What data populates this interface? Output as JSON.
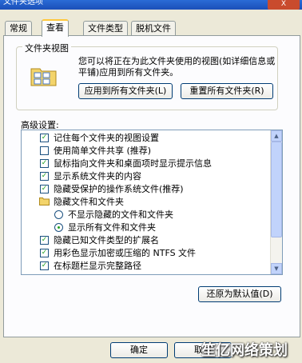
{
  "window": {
    "title": "文件夹选项",
    "close_label": "X"
  },
  "tabs": [
    {
      "label": "常规"
    },
    {
      "label": "查看"
    },
    {
      "label": "文件类型"
    },
    {
      "label": "脱机文件"
    }
  ],
  "folder_views": {
    "group_label": "文件夹视图",
    "description": "您可以将正在为此文件夹使用的视图(如详细信息或平铺)应用到所有文件夹。",
    "apply_button": "应用到所有文件夹(L)",
    "reset_button": "重置所有文件夹(R)"
  },
  "advanced": {
    "label": "高级设置:",
    "items": [
      {
        "text": "记住每个文件夹的视图设置",
        "kind": "checkbox",
        "checked": true
      },
      {
        "text": "使用简单文件共享 (推荐)",
        "kind": "checkbox",
        "checked": false
      },
      {
        "text": "鼠标指向文件夹和桌面项时显示提示信息",
        "kind": "checkbox",
        "checked": true
      },
      {
        "text": "显示系统文件夹的内容",
        "kind": "checkbox",
        "checked": true
      },
      {
        "text": "隐藏受保护的操作系统文件(推荐)",
        "kind": "checkbox",
        "checked": true
      },
      {
        "text": "隐藏文件和文件夹",
        "kind": "folder",
        "checked": false
      },
      {
        "text": "不显示隐藏的文件和文件夹",
        "kind": "radio",
        "checked": false
      },
      {
        "text": "显示所有文件和文件夹",
        "kind": "radio",
        "checked": true
      },
      {
        "text": "隐藏已知文件类型的扩展名",
        "kind": "checkbox",
        "checked": true
      },
      {
        "text": "用彩色显示加密或压缩的 NTFS 文件",
        "kind": "checkbox",
        "checked": true
      },
      {
        "text": "在标题栏显示完整路径",
        "kind": "checkbox",
        "checked": true
      }
    ]
  },
  "restore_button": "还原为默认值(D)",
  "ok_button": "确定",
  "cancel_button": "取消",
  "watermark": "笙亿网络策划"
}
